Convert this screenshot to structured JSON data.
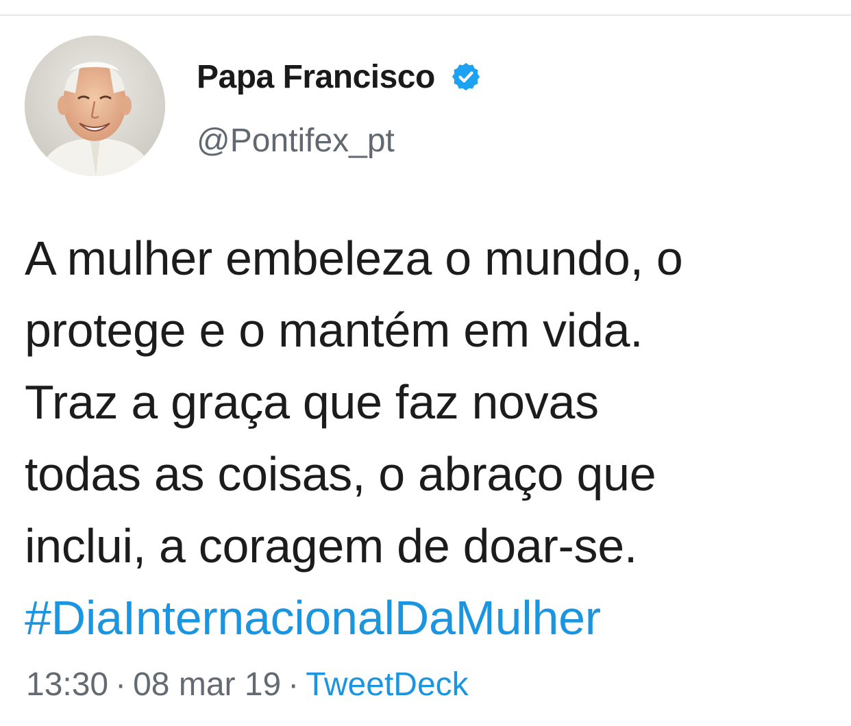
{
  "tweet": {
    "author": {
      "display_name": "Papa Francisco",
      "handle": "@Pontifex_pt",
      "verified": true
    },
    "text_lines": [
      "A mulher embeleza o mundo, o",
      "protege e o mantém em vida.",
      "Traz a graça que faz novas",
      "todas as coisas, o abraço que",
      "inclui, a coragem de doar-se."
    ],
    "hashtag": "#DiaInternacionalDaMulher",
    "time": "13:30",
    "separator": "·",
    "date": "08 mar 19",
    "source": "TweetDeck"
  },
  "colors": {
    "link": "#1b95e0",
    "verified_badge": "#1da1f2",
    "text": "#1c1c1c",
    "secondary_text": "#636a72"
  },
  "icons": {
    "verified": "verified-badge-icon",
    "avatar": "profile-photo"
  }
}
